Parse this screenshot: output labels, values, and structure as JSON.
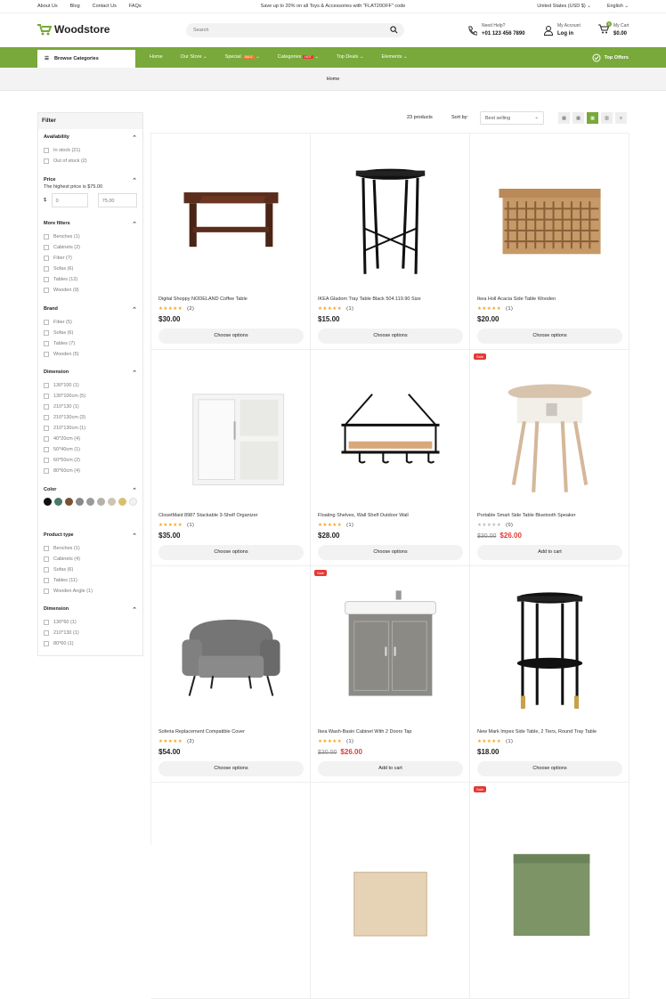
{
  "topbar": {
    "links": [
      "About Us",
      "Blog",
      "Contact Us",
      "FAQs"
    ],
    "promo": "Save up to 20% on all Toys & Accessories with \"FLAT20OFF\" code",
    "region": "United States (USD $)",
    "language": "English"
  },
  "header": {
    "logo": "Woodstore",
    "search_placeholder": "Search",
    "help_label": "Need Help?",
    "help_phone": "+01 123 456 7890",
    "account_label": "My Account",
    "account_action": "Log in",
    "cart_label": "My Cart",
    "cart_total": "$0.00",
    "cart_count": "0"
  },
  "nav": {
    "browse": "Browse Categories",
    "items": [
      "Home",
      "Our Store",
      "Special",
      "Categories",
      "Top Deals",
      "Elements"
    ],
    "special_badge": "SALE",
    "categories_badge": "HOT",
    "top_offers": "Top Offers"
  },
  "breadcrumb": "Home",
  "filter": {
    "title": "Filter",
    "availability": {
      "title": "Availability",
      "options": [
        "In stock (21)",
        "Out of stock (2)"
      ]
    },
    "price": {
      "title": "Price",
      "note": "The highest price is $75.00",
      "currency": "$",
      "min": "0",
      "max": "75.00"
    },
    "more_filters": {
      "title": "More filters",
      "options": [
        "Benches (1)",
        "Cabinets (2)",
        "Fiber (7)",
        "Sofas (6)",
        "Tables (12)",
        "Wooden (9)"
      ]
    },
    "brand": {
      "title": "Brand",
      "options": [
        "Fiber (5)",
        "Sofas (6)",
        "Tables (7)",
        "Wooden (5)"
      ]
    },
    "dimension": {
      "title": "Dimension",
      "options": [
        "130*100 (1)",
        "130*100cm (5)",
        "210*130 (1)",
        "210*130cm (3)",
        "210*130cm (1)",
        "40*20cm (4)",
        "50*40cm (1)",
        "60*50cm (2)",
        "80*60cm (4)"
      ]
    },
    "color": {
      "title": "Color",
      "swatches": [
        "#111111",
        "#4a7a6a",
        "#7a5230",
        "#888888",
        "#9a9a9a",
        "#b5b0a8",
        "#cfc4b0",
        "#d8c070",
        "#f2f2f2"
      ]
    },
    "product_type": {
      "title": "Product type",
      "options": [
        "Benches (1)",
        "Cabinets (4)",
        "Sofas (6)",
        "Tables (11)",
        "Wooden Angle (1)"
      ]
    },
    "dimension2": {
      "title": "Dimension",
      "options": [
        "130*60 (1)",
        "210*130 (1)",
        "80*60 (1)"
      ]
    }
  },
  "toolbar": {
    "count": "23 products",
    "sort_label": "Sort by:",
    "sort_value": "Best selling"
  },
  "products": [
    {
      "name": "Digital Shoppy NODELAND Coffee Table",
      "reviews": "(2)",
      "price": "$30.00",
      "old": "",
      "button": "Choose options",
      "sale": "",
      "rated": true
    },
    {
      "name": "IKEA Gladom Tray Table Black 504.119.90 Size",
      "reviews": "(1)",
      "price": "$15.00",
      "old": "",
      "button": "Choose options",
      "sale": "",
      "rated": true
    },
    {
      "name": "Ikea Holl Acacia Side Table Wooden",
      "reviews": "(1)",
      "price": "$20.00",
      "old": "",
      "button": "Choose options",
      "sale": "",
      "rated": true
    },
    {
      "name": "ClosetMaid 8987 Stackable 3-Shelf Organizer",
      "reviews": "(1)",
      "price": "$35.00",
      "old": "",
      "button": "Choose options",
      "sale": "",
      "rated": true
    },
    {
      "name": "Floating Shelves, Wall Shelf Outdoor Wall",
      "reviews": "(1)",
      "price": "$28.00",
      "old": "",
      "button": "Choose options",
      "sale": "",
      "rated": true
    },
    {
      "name": "Portable Smart Side Table Bluetooth Speaker",
      "reviews": "(0)",
      "price": "$26.00",
      "old": "$30.00",
      "button": "Add to cart",
      "sale": "Sale",
      "rated": false
    },
    {
      "name": "Soferia Replacement Compatible Cover",
      "reviews": "(2)",
      "price": "$54.00",
      "old": "",
      "button": "Choose options",
      "sale": "",
      "rated": true
    },
    {
      "name": "Ikea Wash-Basin Cabinet With 2 Doors Tap",
      "reviews": "(1)",
      "price": "$26.00",
      "old": "$30.00",
      "button": "Add to cart",
      "sale": "Sale",
      "rated": true
    },
    {
      "name": "New Mark Impex Side Table, 2 Tiers, Round Tray Table",
      "reviews": "(1)",
      "price": "$18.00",
      "old": "",
      "button": "Choose options",
      "sale": "",
      "rated": true
    },
    {
      "name": "",
      "reviews": "",
      "price": "",
      "old": "",
      "button": "",
      "sale": "",
      "rated": true
    },
    {
      "name": "",
      "reviews": "",
      "price": "",
      "old": "",
      "button": "",
      "sale": "",
      "rated": true
    },
    {
      "name": "",
      "reviews": "",
      "price": "",
      "old": "",
      "button": "",
      "sale": "Sale",
      "rated": true
    }
  ]
}
